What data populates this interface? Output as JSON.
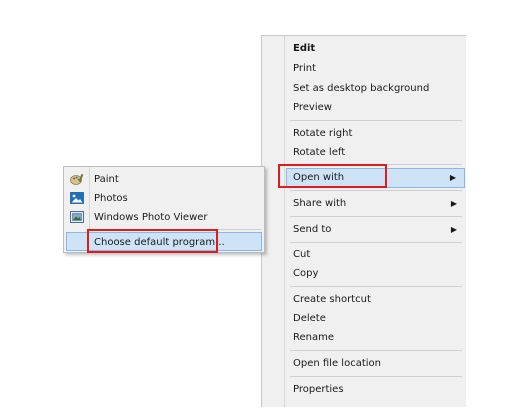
{
  "context_menu": {
    "items": [
      {
        "label": "Edit"
      },
      {
        "label": "Print"
      },
      {
        "label": "Set as desktop background"
      },
      {
        "label": "Preview"
      },
      {
        "label": "Rotate right"
      },
      {
        "label": "Rotate left"
      },
      {
        "label": "Open with",
        "arrow": "▶"
      },
      {
        "label": "Share with",
        "arrow": "▶"
      },
      {
        "label": "Send to",
        "arrow": "▶"
      },
      {
        "label": "Cut"
      },
      {
        "label": "Copy"
      },
      {
        "label": "Create shortcut"
      },
      {
        "label": "Delete"
      },
      {
        "label": "Rename"
      },
      {
        "label": "Open file location"
      },
      {
        "label": "Properties"
      }
    ]
  },
  "open_with_submenu": {
    "items": [
      {
        "label": "Paint",
        "icon": "paint-icon"
      },
      {
        "label": "Photos",
        "icon": "photos-icon"
      },
      {
        "label": "Windows Photo Viewer",
        "icon": "photo-viewer-icon"
      },
      {
        "label": "Choose default program..."
      }
    ]
  },
  "highlight_color": "#cfe3f7",
  "annotation_color": "#e01b1b"
}
